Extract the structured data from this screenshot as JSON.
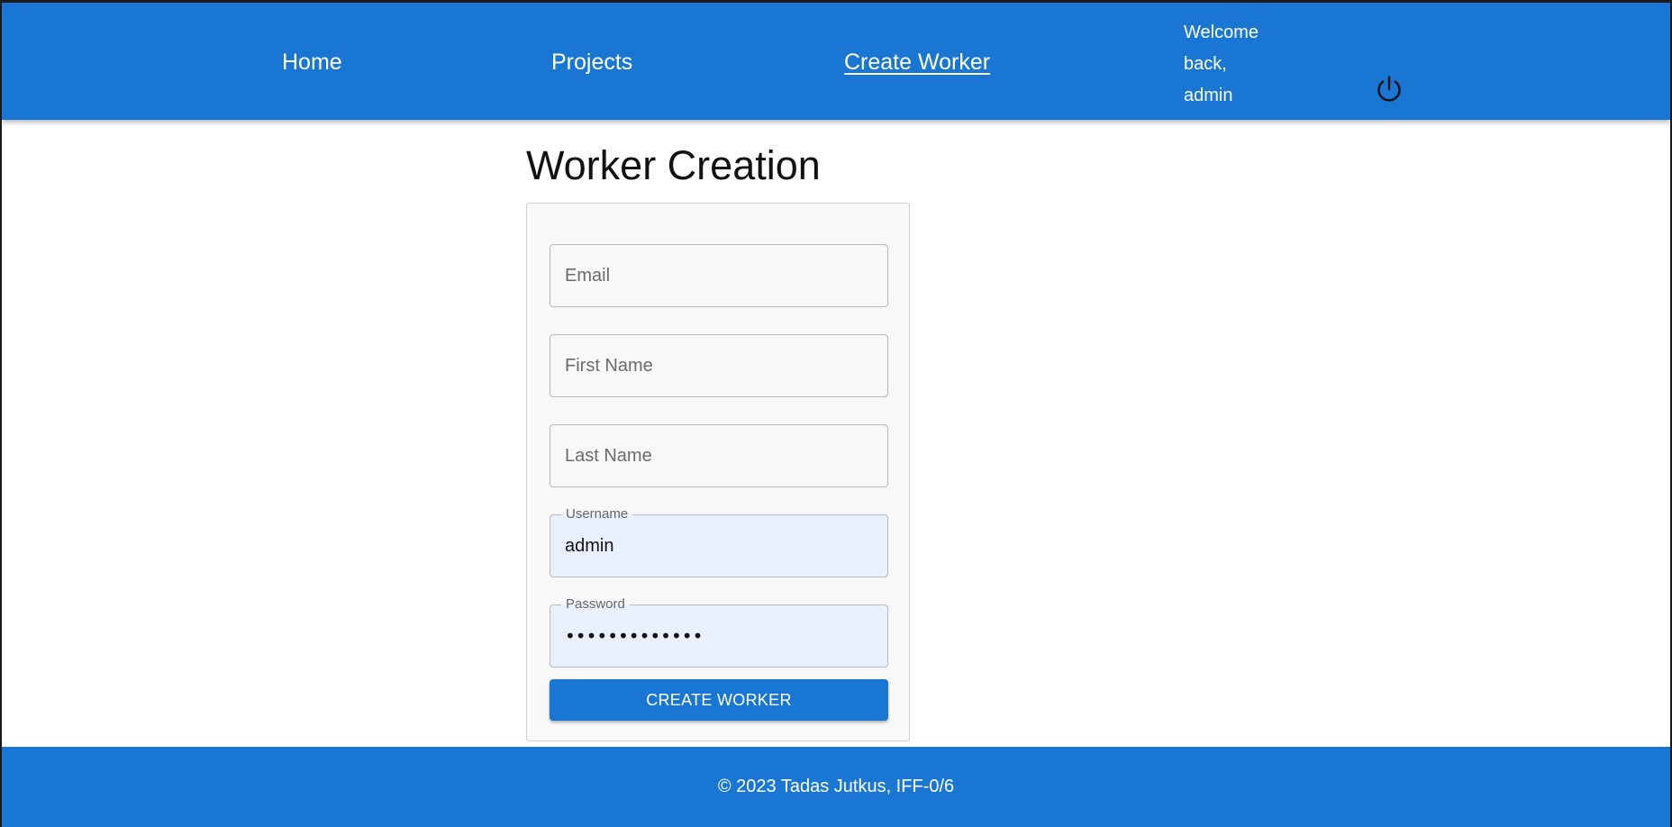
{
  "nav": {
    "home": "Home",
    "projects": "Projects",
    "create_worker": "Create Worker",
    "welcome_line1": "Welcome",
    "welcome_line2": "back,",
    "welcome_line3": "admin",
    "logout_icon": "power-icon"
  },
  "main": {
    "title": "Worker Creation"
  },
  "form": {
    "email_placeholder": "Email",
    "first_name_placeholder": "First Name",
    "last_name_placeholder": "Last Name",
    "username_label": "Username",
    "username_value": "admin",
    "password_label": "Password",
    "password_value": "•••••••••••••",
    "submit_label": "CREATE WORKER"
  },
  "footer": {
    "text": "© 2023 Tadas Jutkus, IFF-0/6"
  },
  "colors": {
    "primary": "#1976d2",
    "autofill": "#e8f0fe"
  }
}
